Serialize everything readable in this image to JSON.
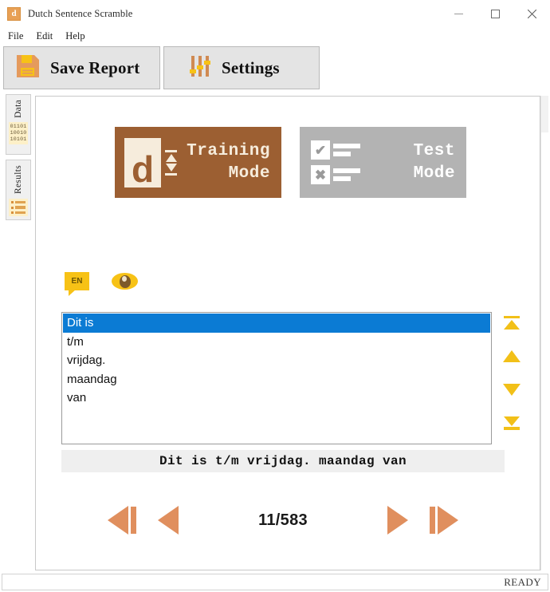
{
  "window": {
    "title": "Dutch Sentence Scramble",
    "app_icon": "d",
    "controls": {
      "minimize": "minimize-icon",
      "maximize": "maximize-icon",
      "close": "close-icon"
    }
  },
  "menu": {
    "items": [
      {
        "label": "File"
      },
      {
        "label": "Edit"
      },
      {
        "label": "Help"
      }
    ]
  },
  "toolbar": {
    "save_report_label": "Save Report",
    "save_report_icon": "floppy-disk-icon",
    "settings_label": "Settings",
    "settings_icon": "sliders-icon"
  },
  "sidebar": {
    "tabs": [
      {
        "label": "Data",
        "icon": "binary-data-icon",
        "binary_rows": [
          "01101",
          "10010",
          "10101"
        ],
        "selected": true
      },
      {
        "label": "Results",
        "icon": "list-icon",
        "selected": false
      }
    ]
  },
  "modes": {
    "training": {
      "line1": "Training",
      "line2": "Mode",
      "icon": "dutch-card-reorder-icon",
      "icon_letter": "d",
      "active": true,
      "color": "#9c5f32"
    },
    "test": {
      "line1": "Test",
      "line2": "Mode",
      "icon": "checkbox-cross-icon",
      "check_glyph": "✔",
      "cross_glyph": "✖",
      "active": false,
      "color": "#b3b3b3"
    }
  },
  "badges": {
    "language": "EN",
    "language_icon": "speech-bubble-icon",
    "reveal_icon": "eye-icon"
  },
  "scramble": {
    "items": [
      {
        "text": "Dit is",
        "selected": true
      },
      {
        "text": "t/m",
        "selected": false
      },
      {
        "text": "vrijdag.",
        "selected": false
      },
      {
        "text": "maandag",
        "selected": false
      },
      {
        "text": "van",
        "selected": false
      }
    ],
    "selection_color": "#0b7bd4",
    "preview": "Dit is t/m vrijdag. maandag van"
  },
  "reorder": {
    "buttons": [
      {
        "name": "move-to-top",
        "icon": "arrow-to-top-icon"
      },
      {
        "name": "move-up",
        "icon": "arrow-up-icon"
      },
      {
        "name": "move-down",
        "icon": "arrow-down-icon"
      },
      {
        "name": "move-to-bottom",
        "icon": "arrow-to-bottom-icon"
      }
    ],
    "color": "#f2c018"
  },
  "navigation": {
    "first_icon": "skip-to-first-icon",
    "prev_icon": "previous-icon",
    "next_icon": "next-icon",
    "last_icon": "skip-to-last-icon",
    "counter": "11/583",
    "current": 11,
    "total": 583,
    "color": "#e08f5e"
  },
  "status": {
    "text": "READY"
  }
}
